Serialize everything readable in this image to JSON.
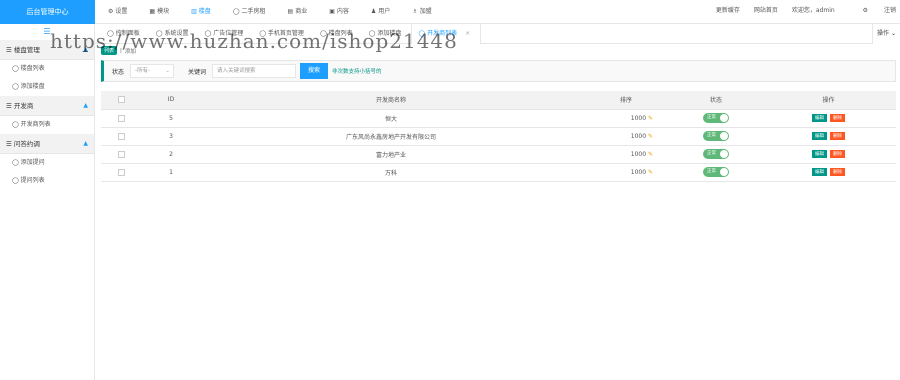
{
  "brand": "后台管理中心",
  "topnav": [
    {
      "icon": "gear-icon",
      "glyph": "⚙",
      "label": "设置"
    },
    {
      "icon": "grid-icon",
      "glyph": "▦",
      "label": "模块"
    },
    {
      "icon": "building-icon",
      "glyph": "▥",
      "label": "楼盘"
    },
    {
      "icon": "circle-icon",
      "glyph": "◯",
      "label": "二手房租"
    },
    {
      "icon": "shop-icon",
      "glyph": "▤",
      "label": "商业"
    },
    {
      "icon": "document-icon",
      "glyph": "▣",
      "label": "内容"
    },
    {
      "icon": "user-icon",
      "glyph": "♟",
      "label": "用户"
    },
    {
      "icon": "plugin-icon",
      "glyph": "♗",
      "label": "加盟"
    }
  ],
  "topright": {
    "cache": "更新缓存",
    "home": "网站首页",
    "welcome": "欢迎您，admin",
    "logout": "注销",
    "logout_icon": "⚙"
  },
  "sidebar": {
    "toggle": "☰",
    "groups": [
      {
        "title": "楼盘管理",
        "items": [
          "楼盘列表",
          "添加楼盘"
        ]
      },
      {
        "title": "开发商",
        "items": [
          "开发商列表"
        ]
      },
      {
        "title": "问答约调",
        "items": [
          "添加提问",
          "提问列表"
        ]
      }
    ]
  },
  "tabs": [
    "控制面板",
    "系统设置",
    "广告位管理",
    "手机首页管理",
    "楼盘列表",
    "添加楼盘",
    "开发商列表"
  ],
  "tabs_close": "×",
  "tabs_operation": "操作",
  "breadcrumb": {
    "badge": "列表",
    "separator": "|",
    "link": "添加"
  },
  "watermark": "https://www.huzhan.com/ishop21448",
  "filter": {
    "status_label": "状态",
    "status_value": "-所有-",
    "keyword_label": "关键词",
    "keyword_placeholder": "请入关键词搜索",
    "search_button": "搜索",
    "hint": "非次数支持小括号的"
  },
  "table": {
    "headers": [
      "ID",
      "开发商名称",
      "排序",
      "状态",
      "操作"
    ],
    "rows": [
      {
        "id": "5",
        "name": "恒大",
        "sort": "1000",
        "status": "正常",
        "edit": "编辑",
        "delete": "删除"
      },
      {
        "id": "3",
        "name": "广东风尚永鑫房地产开发有限公司",
        "sort": "1000",
        "status": "正常",
        "edit": "编辑",
        "delete": "删除"
      },
      {
        "id": "2",
        "name": "富力地产业",
        "sort": "1000",
        "status": "正常",
        "edit": "编辑",
        "delete": "删除"
      },
      {
        "id": "1",
        "name": "万科",
        "sort": "1000",
        "status": "正常",
        "edit": "编辑",
        "delete": "删除"
      }
    ]
  },
  "colors": {
    "accent": "#1E9FFF",
    "green": "#009688",
    "toggle": "#5FB878",
    "danger": "#FF5722"
  }
}
